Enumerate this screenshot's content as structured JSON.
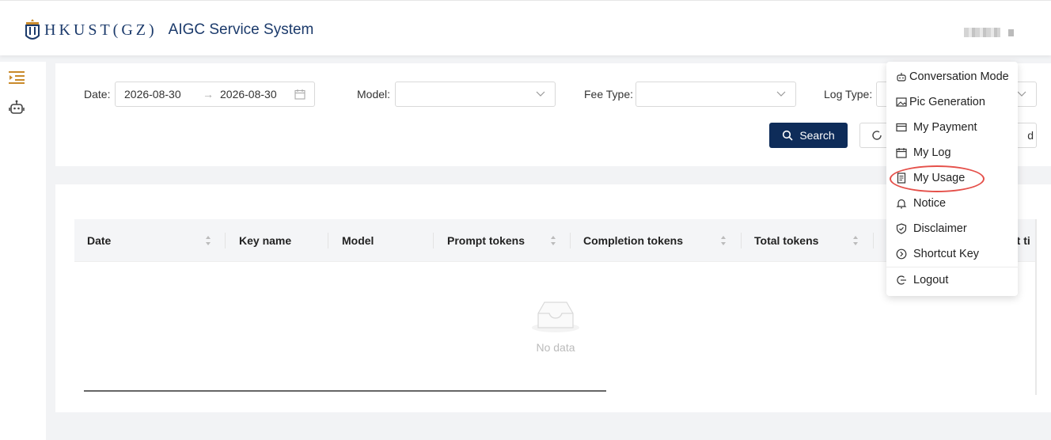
{
  "header": {
    "brand": "HKUST(GZ)",
    "app_title": "AIGC Service System"
  },
  "filters": {
    "date_label": "Date:",
    "date_start": "2026-08-30",
    "date_separator": "→",
    "date_end": "2026-08-30",
    "model_label": "Model:",
    "fee_type_label": "Fee Type:",
    "log_type_label": "Log Type:",
    "search_label": "Search",
    "reset_tail": "d"
  },
  "table": {
    "columns": [
      "Date",
      "Key name",
      "Model",
      "Prompt tokens",
      "Completion tokens",
      "Total tokens",
      "tt ti"
    ],
    "empty_text": "No data"
  },
  "menu": {
    "items": [
      {
        "label": "Conversation Mode",
        "icon": "robot-icon"
      },
      {
        "label": "Pic Generation",
        "icon": "image-icon"
      },
      {
        "label": "My Payment",
        "icon": "payment-card-icon"
      },
      {
        "label": "My Log",
        "icon": "calendar-icon"
      },
      {
        "label": "My Usage",
        "icon": "usage-document-icon"
      },
      {
        "label": "Notice",
        "icon": "bell-icon"
      },
      {
        "label": "Disclaimer",
        "icon": "shield-check-icon"
      },
      {
        "label": "Shortcut Key",
        "icon": "circle-arrow-icon"
      },
      {
        "label": "Logout",
        "icon": "logout-icon"
      }
    ]
  },
  "colors": {
    "primary": "#0e2c59",
    "brand": "#1b3a6b",
    "highlight_ring": "#e5504a",
    "sidebar_accent": "#c98a2b"
  }
}
